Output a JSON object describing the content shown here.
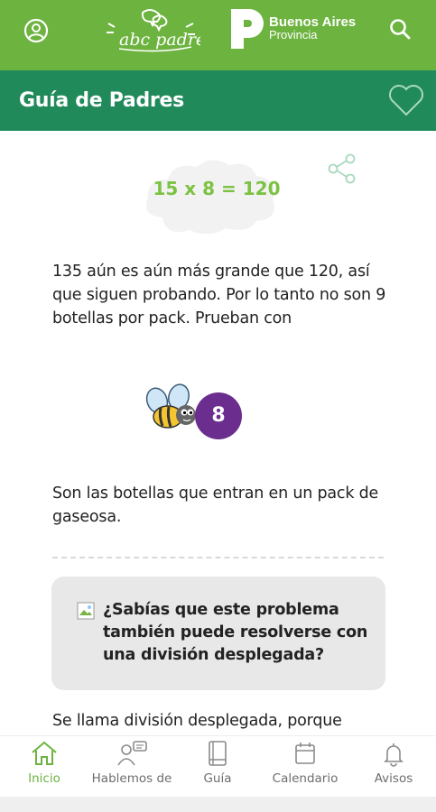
{
  "header": {
    "brand_logo_text": "abc padres",
    "province_line1": "Buenos Aires",
    "province_line2": "Provincia",
    "icons": [
      "user-icon",
      "search-icon"
    ]
  },
  "subheader": {
    "title": "Guía de Padres",
    "icons": [
      "share-icon",
      "heart-icon"
    ]
  },
  "content": {
    "equation": "15 x 8 = 120",
    "paragraph1": "135 aún es aún más grande que 120, así que siguen probando. Por lo tanto no son 9 botellas por pack. Prueban con",
    "bee_number": "8",
    "paragraph2": "Son las botellas que entran en un pack de gaseosa.",
    "tip": "¿Sabías que este problema también puede resolverse con una división desplegada?",
    "paragraph3": "Se llama división desplegada, porque"
  },
  "bottom_nav": {
    "items": [
      {
        "label": "Inicio",
        "icon": "home-icon",
        "active": true
      },
      {
        "label": "Hablemos de",
        "icon": "chat-person-icon",
        "active": false
      },
      {
        "label": "Guía",
        "icon": "book-icon",
        "active": false
      },
      {
        "label": "Calendario",
        "icon": "calendar-icon",
        "active": false
      },
      {
        "label": "Avisos",
        "icon": "bell-icon",
        "active": false
      }
    ]
  },
  "colors": {
    "header_green": "#6db33f",
    "subheader_green": "#208a5b",
    "equation_green": "#7cc242",
    "badge_purple": "#6b2d8e"
  }
}
